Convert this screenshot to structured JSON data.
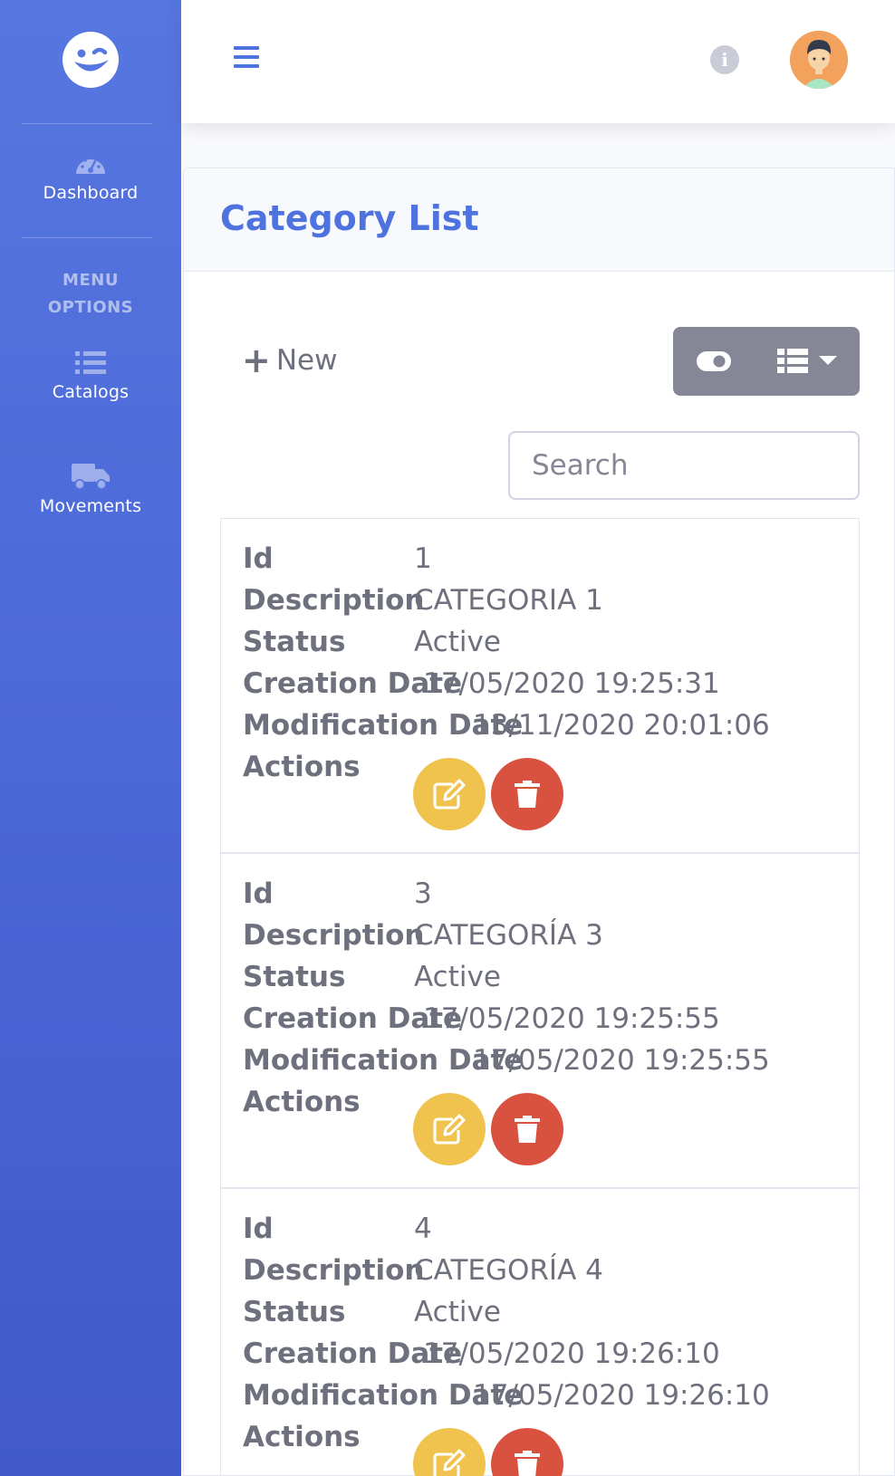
{
  "sidebar": {
    "brand_icon": "winking-face-icon",
    "items": [
      {
        "label": "Dashboard",
        "icon": "tachometer-icon"
      },
      {
        "label": "Catalogs",
        "icon": "list-icon"
      },
      {
        "label": "Movements",
        "icon": "truck-icon"
      }
    ],
    "heading_line1": "MENU",
    "heading_line2": "OPTIONS"
  },
  "topbar": {
    "menu_icon": "hamburger-icon",
    "info_icon": "info-icon",
    "info_glyph": "i",
    "avatar": "user-avatar"
  },
  "page": {
    "title": "Category List",
    "new_label": "New",
    "search_placeholder": "Search"
  },
  "labels": {
    "id": "Id",
    "description": "Description",
    "status": "Status",
    "creation_date": "Creation Date",
    "modification_date": "Modification Date",
    "actions": "Actions"
  },
  "records": [
    {
      "id": "1",
      "description": "CATEGORIA 1",
      "status": "Active",
      "creation_date": "17/05/2020 19:25:31",
      "modification_date": "13/11/2020 20:01:06"
    },
    {
      "id": "3",
      "description": "CATEGORÍA 3",
      "status": "Active",
      "creation_date": "17/05/2020 19:25:55",
      "modification_date": "17/05/2020 19:25:55"
    },
    {
      "id": "4",
      "description": "CATEGORÍA 4",
      "status": "Active",
      "creation_date": "17/05/2020 19:26:10",
      "modification_date": "17/05/2020 19:26:10"
    }
  ],
  "colors": {
    "primary": "#4e73df",
    "edit": "#efc34e",
    "delete": "#d9523f",
    "text": "#6e707e"
  }
}
